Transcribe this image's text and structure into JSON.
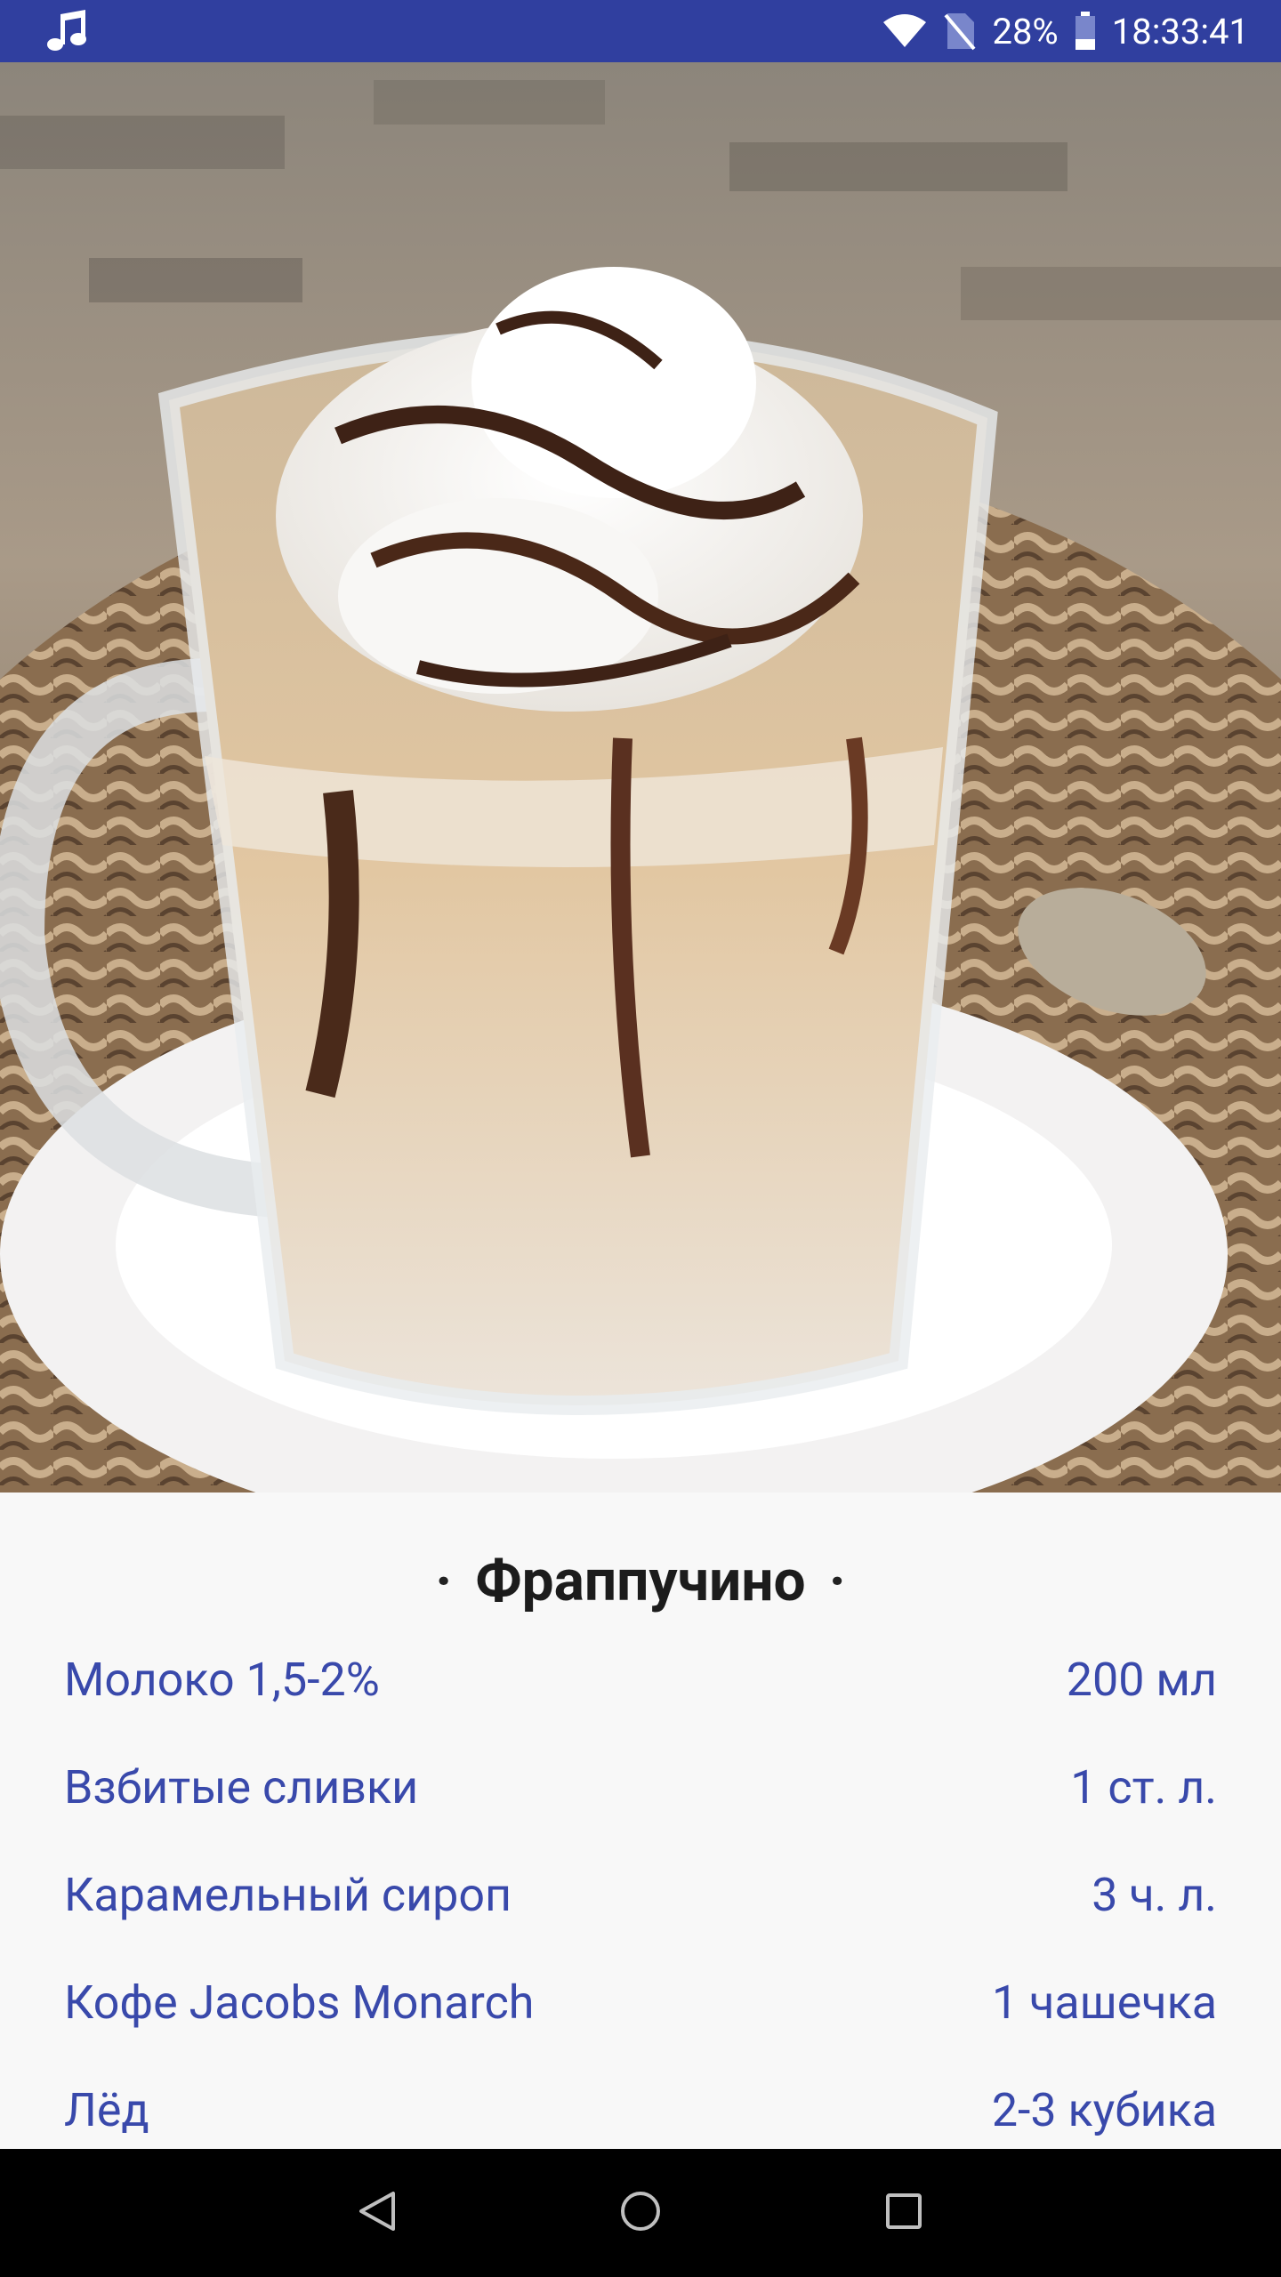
{
  "status_bar": {
    "battery": "28%",
    "time": "18:33:41",
    "icons": [
      "music-note-icon",
      "wifi-icon",
      "no-sim-icon",
      "battery-icon"
    ]
  },
  "hero_image": {
    "icon": "frappuccino-photo"
  },
  "recipe": {
    "dot_left": "·",
    "title": "Фраппучино",
    "dot_right": "·",
    "ingredients": [
      {
        "name": "Молоко 1,5-2%",
        "amount": "200 мл"
      },
      {
        "name": "Взбитые сливки",
        "amount": "1 ст. л."
      },
      {
        "name": "Карамельный сироп",
        "amount": "3 ч. л."
      },
      {
        "name": "Кофе Jacobs Monarch",
        "amount": "1 чашечка"
      },
      {
        "name": "Лёд",
        "amount": "2-3 кубика"
      }
    ]
  },
  "nav_bar": {
    "icons": [
      "back-icon",
      "home-icon",
      "recents-icon"
    ]
  },
  "colors": {
    "status_bar": "#303f9f",
    "ingredient_text": "#3949ab",
    "title_text": "#1c1c1c",
    "background": "#f8f8f8"
  }
}
